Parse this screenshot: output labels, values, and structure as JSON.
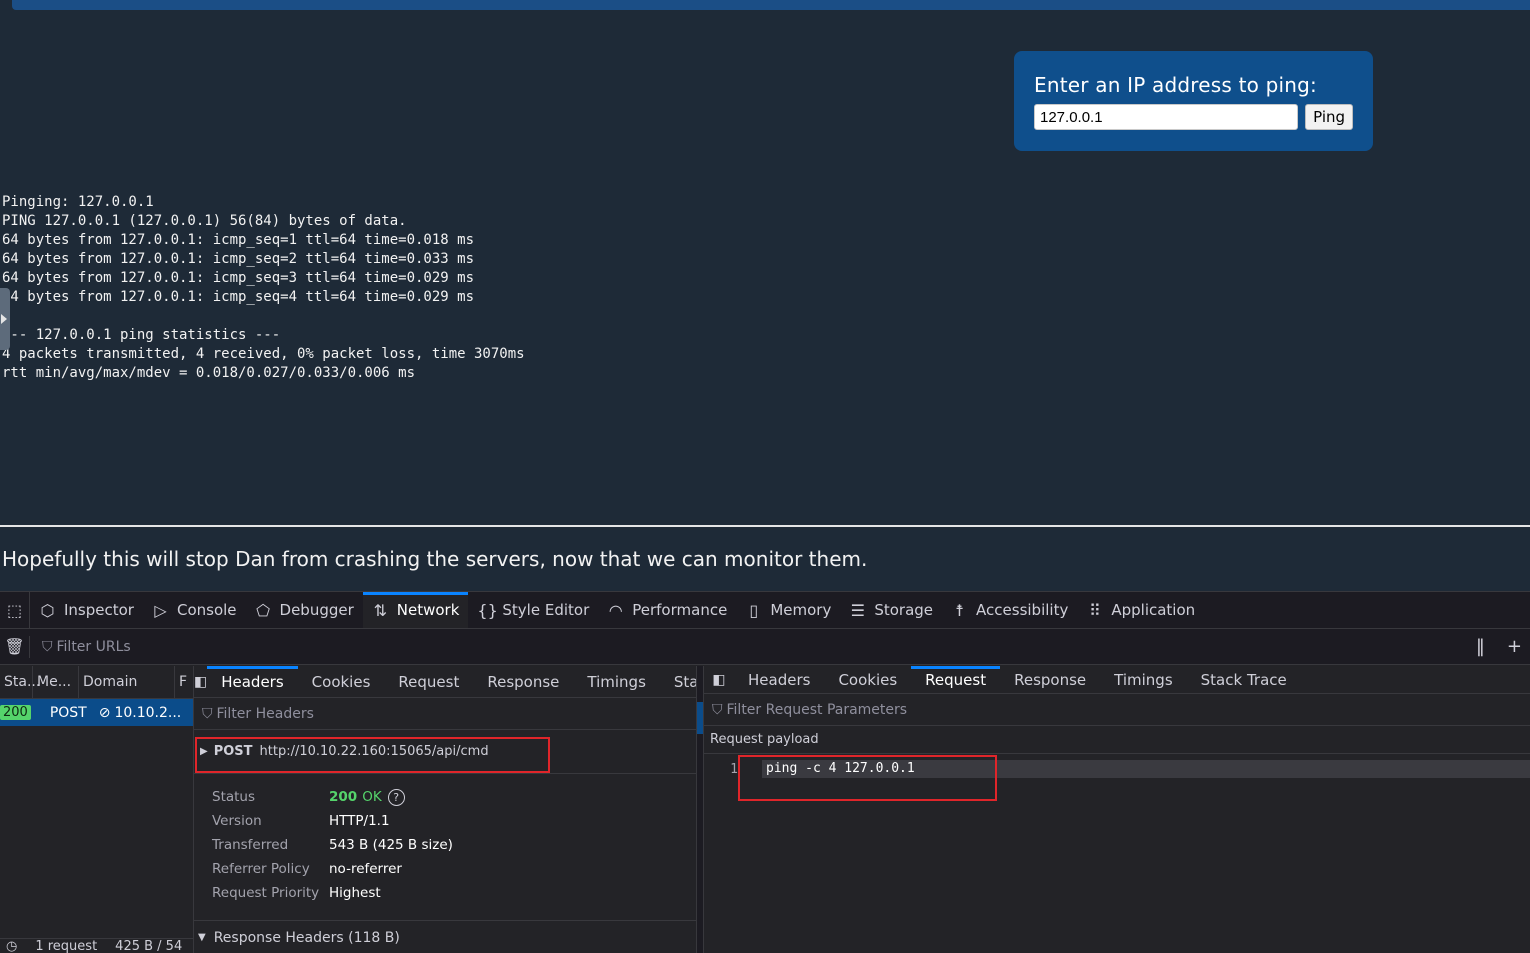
{
  "page": {
    "ping_label": "Enter an IP address to ping:",
    "ip_value": "127.0.0.1",
    "ping_button": "Ping",
    "output_lines": [
      "Pinging: 127.0.0.1",
      "PING 127.0.0.1 (127.0.0.1) 56(84) bytes of data.",
      "64 bytes from 127.0.0.1: icmp_seq=1 ttl=64 time=0.018 ms",
      "64 bytes from 127.0.0.1: icmp_seq=2 ttl=64 time=0.033 ms",
      "64 bytes from 127.0.0.1: icmp_seq=3 ttl=64 time=0.029 ms",
      "64 bytes from 127.0.0.1: icmp_seq=4 ttl=64 time=0.029 ms",
      "",
      "--- 127.0.0.1 ping statistics ---",
      "4 packets transmitted, 4 received, 0% packet loss, time 3070ms",
      "rtt min/avg/max/mdev = 0.018/0.027/0.033/0.006 ms"
    ],
    "footer": "Hopefully this will stop Dan from crashing the servers, now that we can monitor them."
  },
  "devtools": {
    "tabs": [
      {
        "label": "Inspector",
        "icon": "inspector-icon",
        "glyph": "⬡"
      },
      {
        "label": "Console",
        "icon": "console-icon",
        "glyph": "▷"
      },
      {
        "label": "Debugger",
        "icon": "debugger-icon",
        "glyph": "⬠"
      },
      {
        "label": "Network",
        "icon": "network-icon",
        "glyph": "⇅"
      },
      {
        "label": "Style Editor",
        "icon": "style-editor-icon",
        "glyph": "{}"
      },
      {
        "label": "Performance",
        "icon": "performance-icon",
        "glyph": "◠"
      },
      {
        "label": "Memory",
        "icon": "memory-icon",
        "glyph": "▯"
      },
      {
        "label": "Storage",
        "icon": "storage-icon",
        "glyph": "☰"
      },
      {
        "label": "Accessibility",
        "icon": "accessibility-icon",
        "glyph": "☨"
      },
      {
        "label": "Application",
        "icon": "application-icon",
        "glyph": "⠿"
      }
    ],
    "active_tab": "Network",
    "filter_urls_placeholder": "Filter URLs",
    "columns": [
      "Sta...",
      "Me...",
      "Domain",
      "F"
    ],
    "request": {
      "status": "200",
      "method": "POST",
      "domain": "10.10.2..."
    },
    "status_bar": {
      "requests": "1 request",
      "size": "425 B / 54"
    },
    "headers_panel": {
      "tabs": [
        "Headers",
        "Cookies",
        "Request",
        "Response",
        "Timings",
        "Stack"
      ],
      "active": "Headers",
      "filter_placeholder": "Filter Headers",
      "method": "POST",
      "url": "http://10.10.22.160:15065/api/cmd",
      "rows": [
        {
          "key": "Status",
          "value": "200",
          "extra": "OK"
        },
        {
          "key": "Version",
          "value": "HTTP/1.1"
        },
        {
          "key": "Transferred",
          "value": "543 B (425 B size)"
        },
        {
          "key": "Referrer Policy",
          "value": "no-referrer"
        },
        {
          "key": "Request Priority",
          "value": "Highest"
        }
      ],
      "response_headers": "Response Headers (118 B)"
    },
    "request_panel": {
      "tabs": [
        "Headers",
        "Cookies",
        "Request",
        "Response",
        "Timings",
        "Stack Trace"
      ],
      "active": "Request",
      "filter_placeholder": "Filter Request Parameters",
      "payload_label": "Request payload",
      "line_number": "1",
      "payload": "ping -c 4 127.0.0.1"
    }
  }
}
